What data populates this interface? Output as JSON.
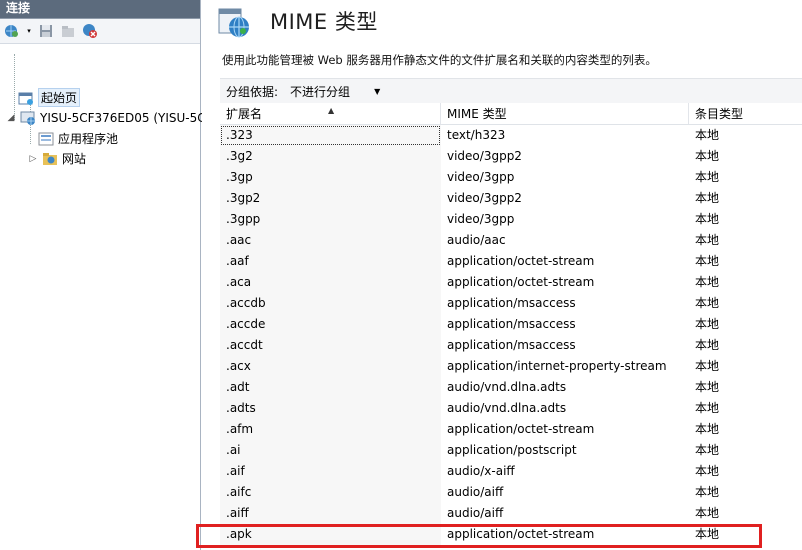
{
  "left_pane": {
    "header": "连接",
    "tree": [
      {
        "label": "起始页"
      },
      {
        "label": "YISU-5CF376ED05 (YISU-5C"
      },
      {
        "label": "应用程序池"
      },
      {
        "label": "网站"
      }
    ]
  },
  "main": {
    "title": "MIME 类型",
    "description": "使用此功能管理被 Web 服务器用作静态文件的文件扩展名和关联的内容类型的列表。",
    "group_by_label": "分组依据:",
    "group_by_value": "不进行分组",
    "columns": [
      "扩展名",
      "MIME 类型",
      "条目类型"
    ],
    "rows": [
      {
        "ext": ".323",
        "mime": "text/h323",
        "type": "本地"
      },
      {
        "ext": ".3g2",
        "mime": "video/3gpp2",
        "type": "本地"
      },
      {
        "ext": ".3gp",
        "mime": "video/3gpp",
        "type": "本地"
      },
      {
        "ext": ".3gp2",
        "mime": "video/3gpp2",
        "type": "本地"
      },
      {
        "ext": ".3gpp",
        "mime": "video/3gpp",
        "type": "本地"
      },
      {
        "ext": ".aac",
        "mime": "audio/aac",
        "type": "本地"
      },
      {
        "ext": ".aaf",
        "mime": "application/octet-stream",
        "type": "本地"
      },
      {
        "ext": ".aca",
        "mime": "application/octet-stream",
        "type": "本地"
      },
      {
        "ext": ".accdb",
        "mime": "application/msaccess",
        "type": "本地"
      },
      {
        "ext": ".accde",
        "mime": "application/msaccess",
        "type": "本地"
      },
      {
        "ext": ".accdt",
        "mime": "application/msaccess",
        "type": "本地"
      },
      {
        "ext": ".acx",
        "mime": "application/internet-property-stream",
        "type": "本地"
      },
      {
        "ext": ".adt",
        "mime": "audio/vnd.dlna.adts",
        "type": "本地"
      },
      {
        "ext": ".adts",
        "mime": "audio/vnd.dlna.adts",
        "type": "本地"
      },
      {
        "ext": ".afm",
        "mime": "application/octet-stream",
        "type": "本地"
      },
      {
        "ext": ".ai",
        "mime": "application/postscript",
        "type": "本地"
      },
      {
        "ext": ".aif",
        "mime": "audio/x-aiff",
        "type": "本地"
      },
      {
        "ext": ".aifc",
        "mime": "audio/aiff",
        "type": "本地"
      },
      {
        "ext": ".aiff",
        "mime": "audio/aiff",
        "type": "本地"
      },
      {
        "ext": ".apk",
        "mime": "application/octet-stream",
        "type": "本地"
      }
    ]
  },
  "colors": {
    "highlight": "#e02020",
    "header_bg": "#5c6b7d"
  }
}
